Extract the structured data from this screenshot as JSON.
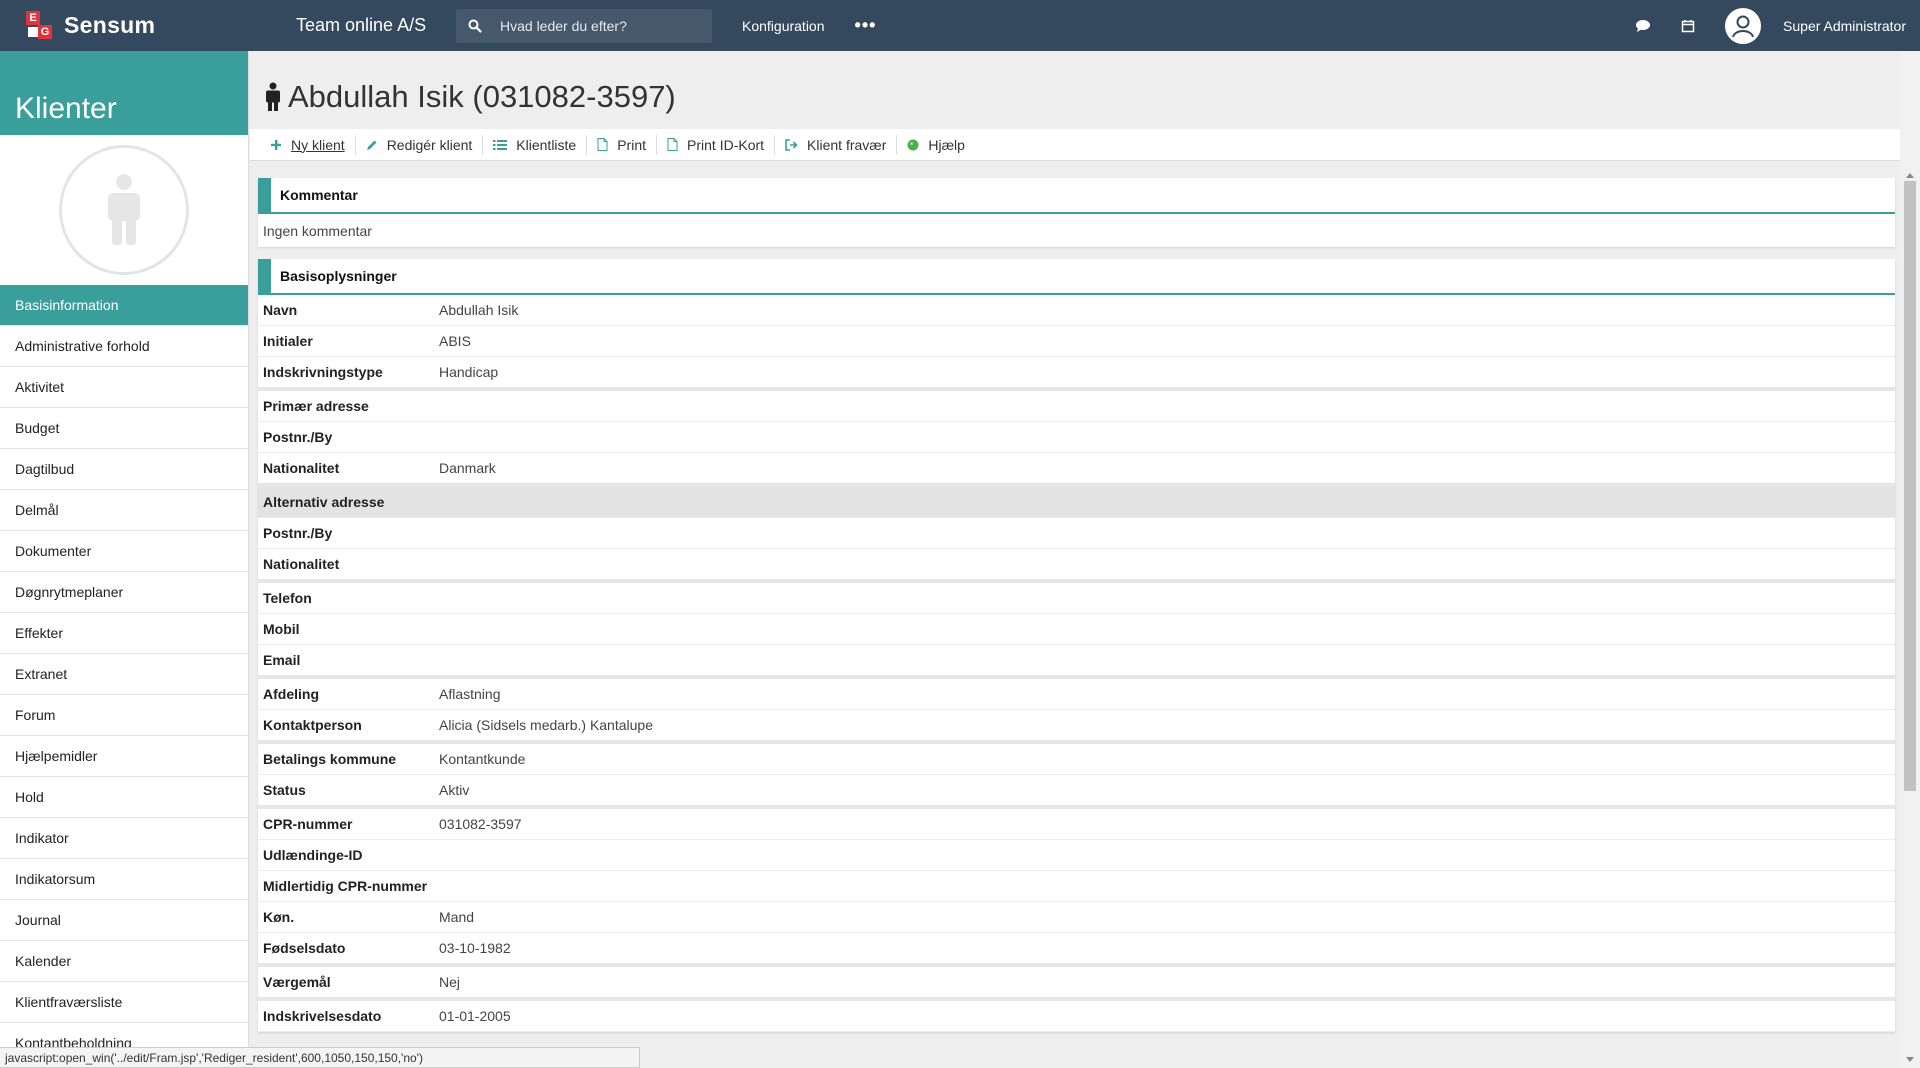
{
  "topbar": {
    "brand": "Sensum",
    "org_name": "Team online A/S",
    "search_placeholder": "Hvad leder du efter?",
    "config_label": "Konfiguration",
    "more_label": "•••",
    "user_name": "Super Administrator"
  },
  "sidebar": {
    "title": "Klienter",
    "items": [
      {
        "label": "Basisinformation"
      },
      {
        "label": "Administrative forhold"
      },
      {
        "label": "Aktivitet"
      },
      {
        "label": "Budget"
      },
      {
        "label": "Dagtilbud"
      },
      {
        "label": "Delmål"
      },
      {
        "label": "Dokumenter"
      },
      {
        "label": "Døgnrytmeplaner"
      },
      {
        "label": "Effekter"
      },
      {
        "label": "Extranet"
      },
      {
        "label": "Forum"
      },
      {
        "label": "Hjælpemidler"
      },
      {
        "label": "Hold"
      },
      {
        "label": "Indikator"
      },
      {
        "label": "Indikatorsum"
      },
      {
        "label": "Journal"
      },
      {
        "label": "Kalender"
      },
      {
        "label": "Klientfraværsliste"
      },
      {
        "label": "Kontantbeholdning"
      }
    ]
  },
  "page": {
    "title": "Abdullah Isik (031082-3597)"
  },
  "toolbar": {
    "new_client": "Ny klient",
    "edit_client": "Redigér klient",
    "client_list": "Klientliste",
    "print": "Print",
    "print_id": "Print ID-Kort",
    "absence": "Klient fravær",
    "help": "Hjælp"
  },
  "comment": {
    "heading": "Kommentar",
    "text": "Ingen kommentar"
  },
  "basis": {
    "heading": "Basisoplysninger",
    "rows": [
      {
        "label": "Navn",
        "value": "Abdullah Isik"
      },
      {
        "label": "Initialer",
        "value": "ABIS"
      },
      {
        "label": "Indskrivningstype",
        "value": "Handicap"
      },
      {
        "label": "Primær adresse",
        "value": ""
      },
      {
        "label": "Postnr./By",
        "value": ""
      },
      {
        "label": "Nationalitet",
        "value": "Danmark"
      },
      {
        "label": "Alternativ adresse",
        "value": ""
      },
      {
        "label": "Postnr./By",
        "value": ""
      },
      {
        "label": "Nationalitet",
        "value": ""
      },
      {
        "label": "Telefon",
        "value": ""
      },
      {
        "label": "Mobil",
        "value": ""
      },
      {
        "label": "Email",
        "value": ""
      },
      {
        "label": "Afdeling",
        "value": "Aflastning"
      },
      {
        "label": "Kontaktperson",
        "value": "Alicia (Sidsels medarb.) Kantalupe"
      },
      {
        "label": "Betalings kommune",
        "value": "Kontantkunde"
      },
      {
        "label": "Status",
        "value": "Aktiv"
      },
      {
        "label": "CPR-nummer",
        "value": "031082-3597"
      },
      {
        "label": "Udlændinge-ID",
        "value": ""
      },
      {
        "label": "Midlertidig CPR-nummer",
        "value": ""
      },
      {
        "label": "Køn.",
        "value": "Mand"
      },
      {
        "label": "Fødselsdato",
        "value": "03-10-1982"
      },
      {
        "label": "Værgemål",
        "value": "Nej"
      },
      {
        "label": "Indskrivelsesdato",
        "value": "01-01-2005"
      }
    ]
  },
  "statusbar": {
    "text": "javascript:open_win('../edit/Fram.jsp','Rediger_resident',600,1050,150,150,'no')"
  },
  "colors": {
    "topbar": "#34495e",
    "accent": "#3a9e9a",
    "brand_red": "#e2343b",
    "help_green": "#4caf50"
  }
}
